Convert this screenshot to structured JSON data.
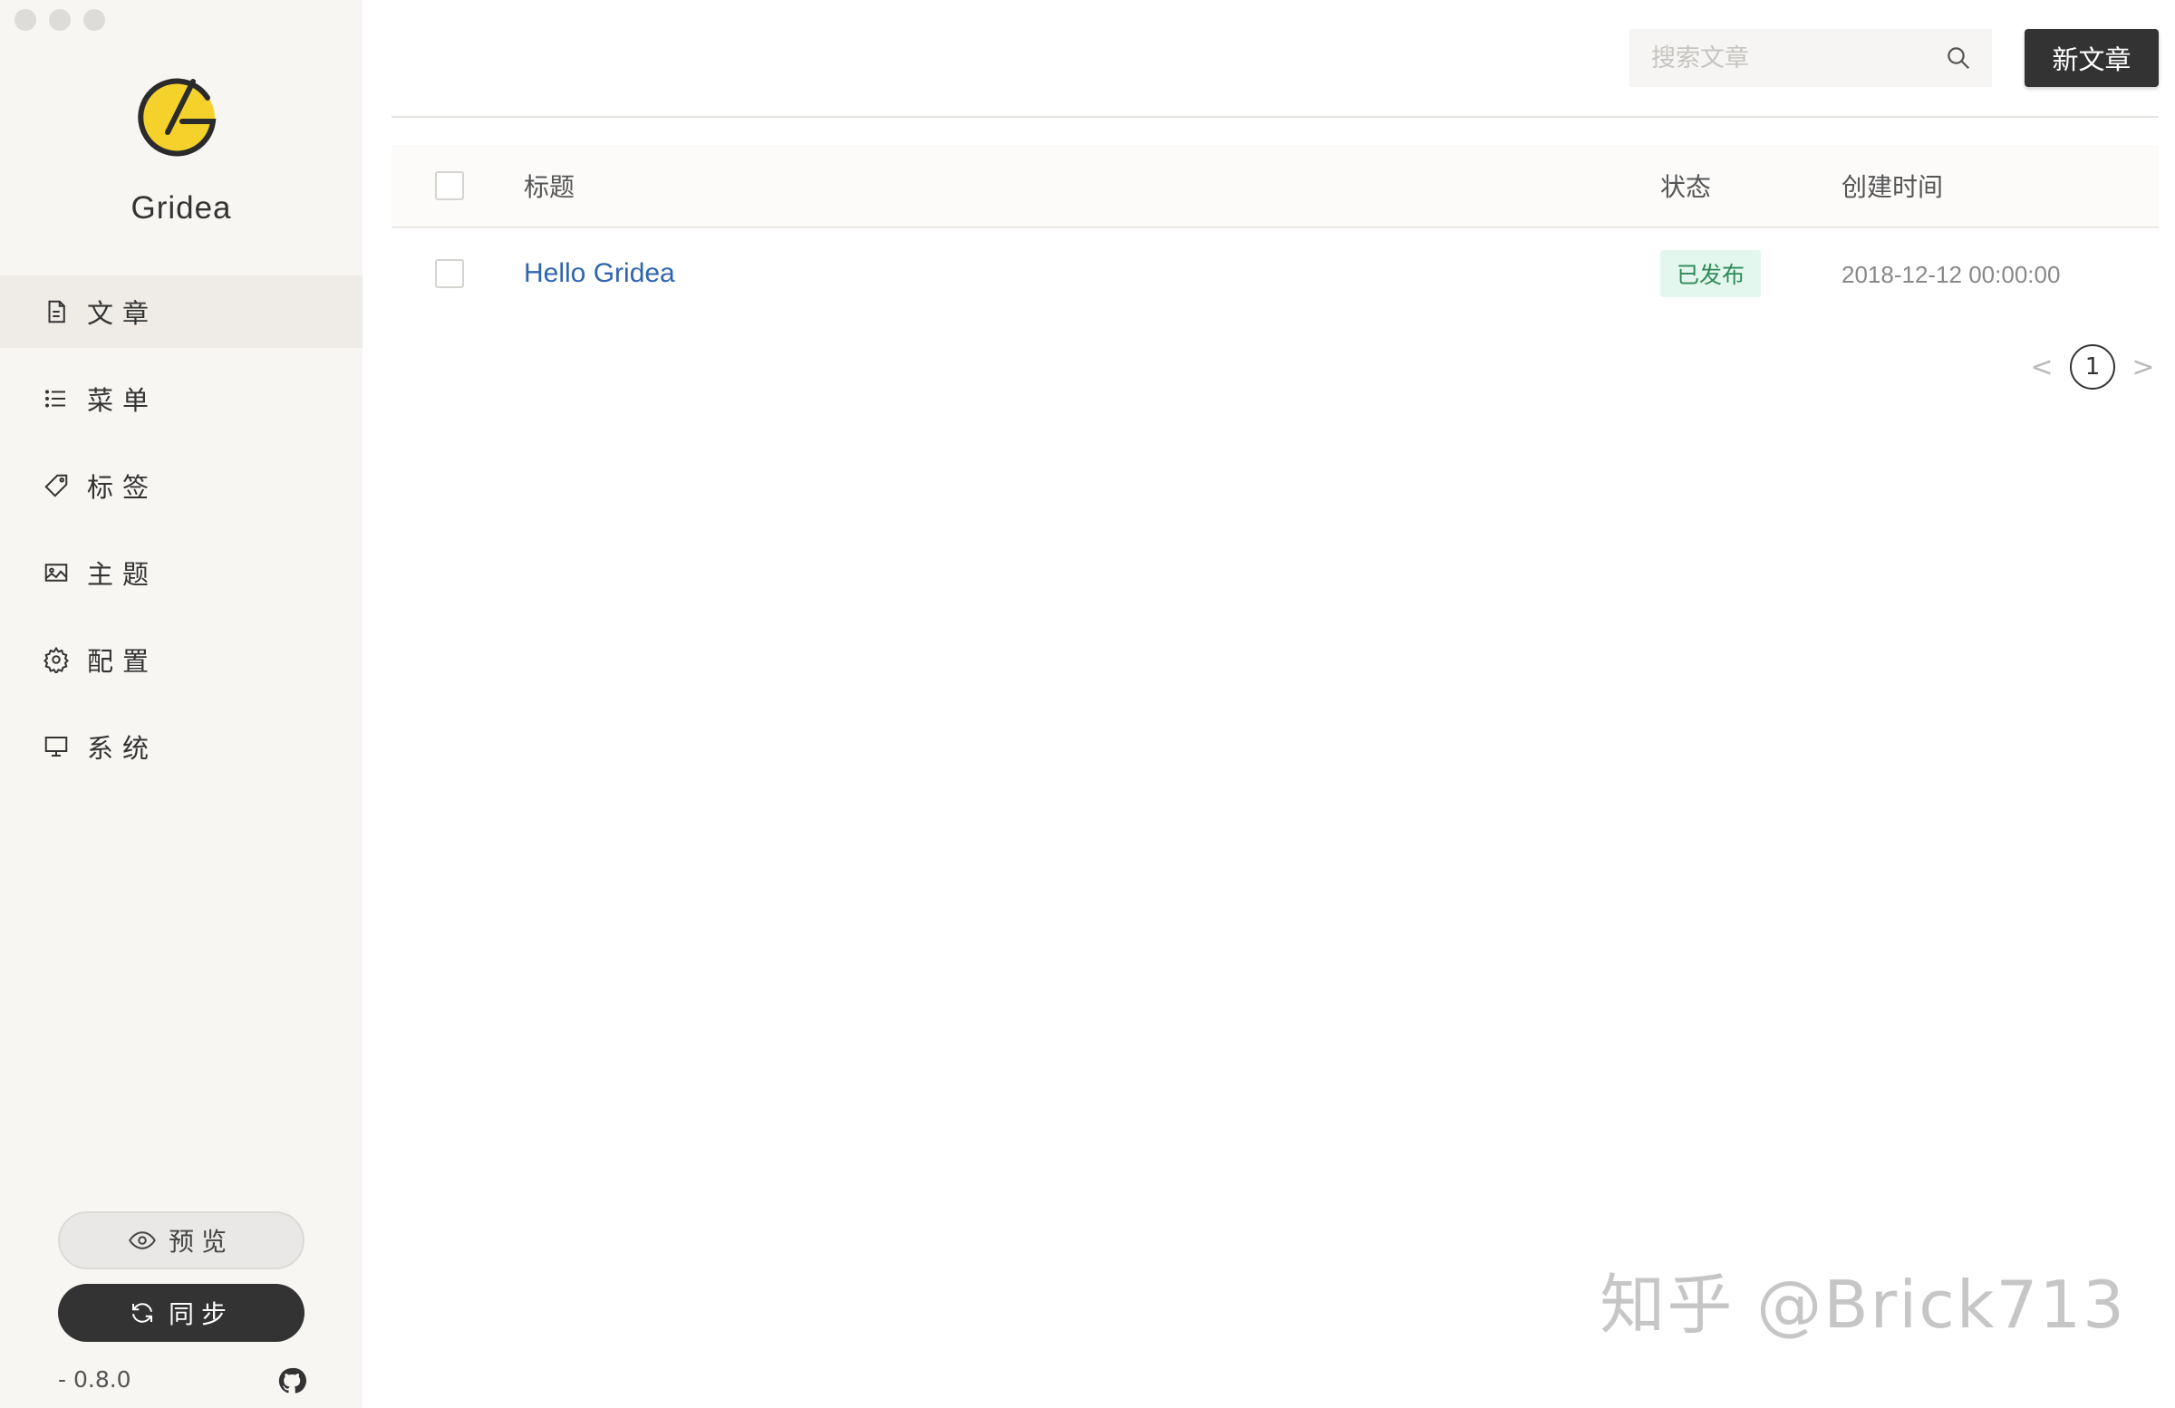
{
  "window": {
    "controls": [
      "close",
      "minimize",
      "zoom"
    ]
  },
  "brand": {
    "name": "Gridea",
    "accent": "#f5d22b"
  },
  "sidebar": {
    "items": [
      {
        "label": "文章",
        "icon": "document-icon",
        "active": true
      },
      {
        "label": "菜单",
        "icon": "list-icon",
        "active": false
      },
      {
        "label": "标签",
        "icon": "tag-icon",
        "active": false
      },
      {
        "label": "主题",
        "icon": "image-icon",
        "active": false
      },
      {
        "label": "配置",
        "icon": "gear-icon",
        "active": false
      },
      {
        "label": "系统",
        "icon": "monitor-icon",
        "active": false
      }
    ],
    "preview_label": "预览",
    "sync_label": "同步",
    "version": "- 0.8.0"
  },
  "toolbar": {
    "search_placeholder": "搜索文章",
    "new_post_label": "新文章"
  },
  "table": {
    "headers": {
      "title": "标题",
      "status": "状态",
      "created": "创建时间"
    },
    "rows": [
      {
        "title": "Hello Gridea",
        "status": "已发布",
        "created": "2018-12-12 00:00:00"
      }
    ]
  },
  "pagination": {
    "current": "1",
    "prev": "<",
    "next": ">"
  },
  "watermark": "知乎 @Brick713"
}
